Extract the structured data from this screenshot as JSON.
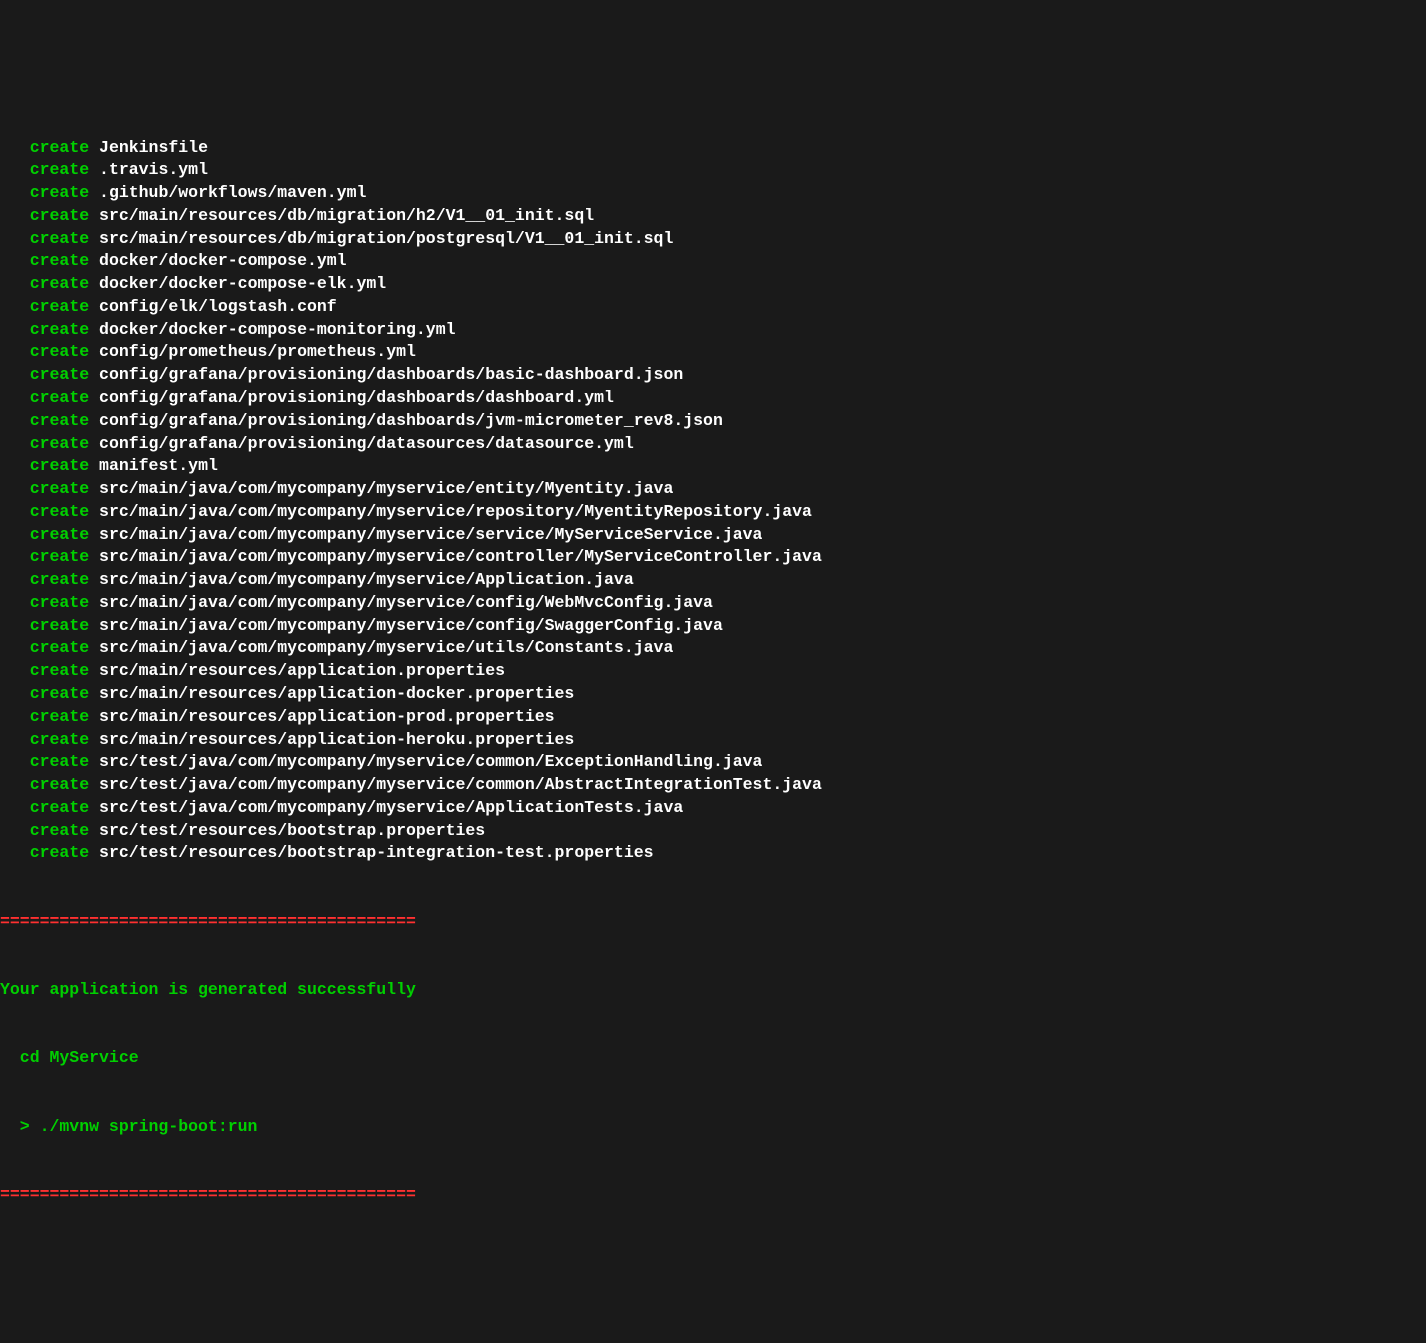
{
  "create_label": "create",
  "indent_create": "   ",
  "files": [
    "Jenkinsfile",
    ".travis.yml",
    ".github/workflows/maven.yml",
    "src/main/resources/db/migration/h2/V1__01_init.sql",
    "src/main/resources/db/migration/postgresql/V1__01_init.sql",
    "docker/docker-compose.yml",
    "docker/docker-compose-elk.yml",
    "config/elk/logstash.conf",
    "docker/docker-compose-monitoring.yml",
    "config/prometheus/prometheus.yml",
    "config/grafana/provisioning/dashboards/basic-dashboard.json",
    "config/grafana/provisioning/dashboards/dashboard.yml",
    "config/grafana/provisioning/dashboards/jvm-micrometer_rev8.json",
    "config/grafana/provisioning/datasources/datasource.yml",
    "manifest.yml",
    "src/main/java/com/mycompany/myservice/entity/Myentity.java",
    "src/main/java/com/mycompany/myservice/repository/MyentityRepository.java",
    "src/main/java/com/mycompany/myservice/service/MyServiceService.java",
    "src/main/java/com/mycompany/myservice/controller/MyServiceController.java",
    "src/main/java/com/mycompany/myservice/Application.java",
    "src/main/java/com/mycompany/myservice/config/WebMvcConfig.java",
    "src/main/java/com/mycompany/myservice/config/SwaggerConfig.java",
    "src/main/java/com/mycompany/myservice/utils/Constants.java",
    "src/main/resources/application.properties",
    "src/main/resources/application-docker.properties",
    "src/main/resources/application-prod.properties",
    "src/main/resources/application-heroku.properties",
    "src/test/java/com/mycompany/myservice/common/ExceptionHandling.java",
    "src/test/java/com/mycompany/myservice/common/AbstractIntegrationTest.java",
    "src/test/java/com/mycompany/myservice/ApplicationTests.java",
    "src/test/resources/bootstrap.properties",
    "src/test/resources/bootstrap-integration-test.properties"
  ],
  "divider": "==========================================",
  "success_message": "Your application is generated successfully",
  "cd_command": "  cd MyService",
  "run_command": "  > ./mvnw spring-boot:run"
}
